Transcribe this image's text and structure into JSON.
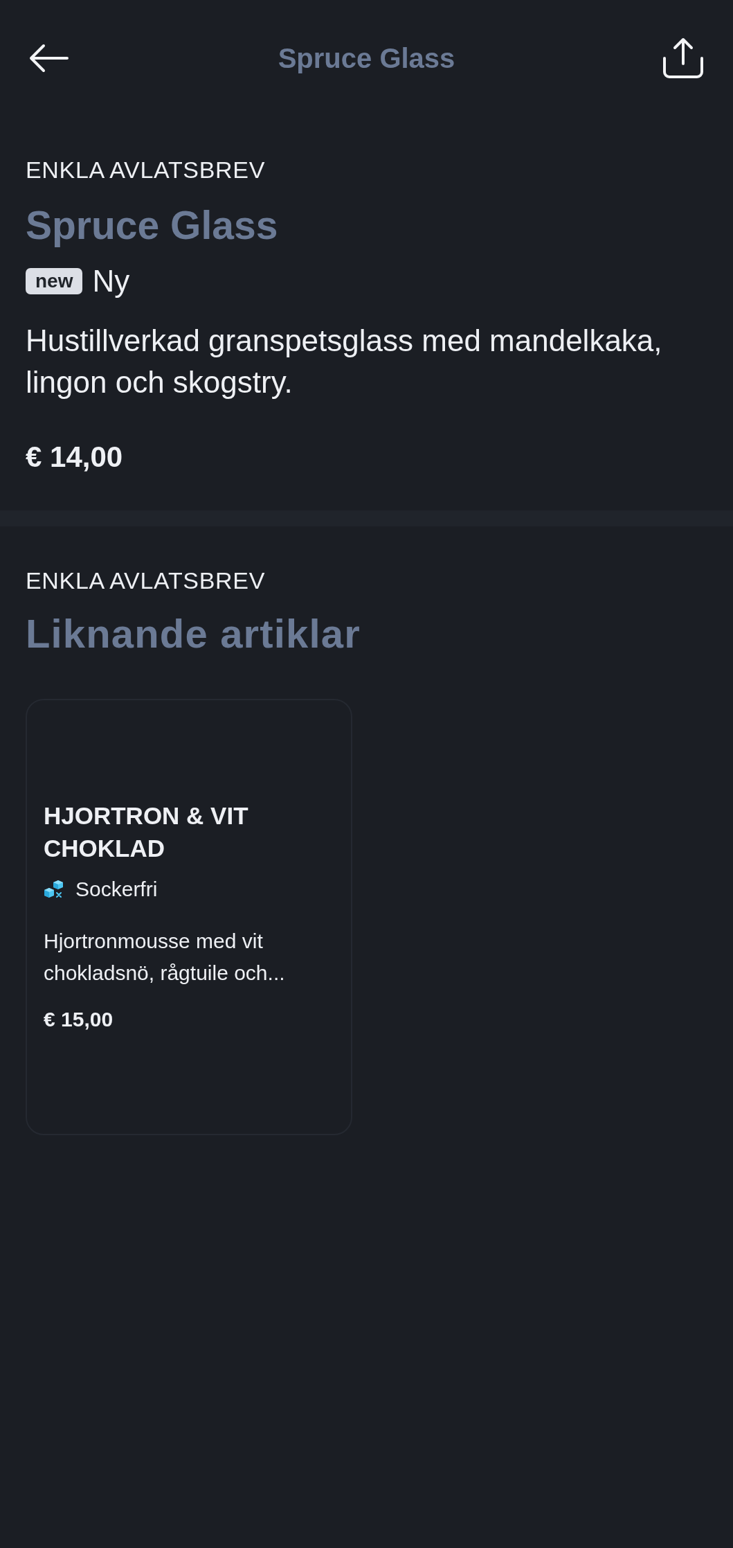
{
  "header": {
    "title": "Spruce Glass"
  },
  "product": {
    "category": "ENKLA AVLATSBREV",
    "name": "Spruce Glass",
    "badges": [
      {
        "tag": "new",
        "label": "Ny"
      }
    ],
    "description": "Hustillverkad granspetsglass med mandelkaka, lingon och skogstry.",
    "price": "€ 14,00"
  },
  "related": {
    "category": "ENKLA AVLATSBREV",
    "heading": "Liknande artiklar",
    "items": [
      {
        "name": "HJORTRON & VIT CHOKLAD",
        "attributes": [
          {
            "kind": "sugar_free",
            "label": "Sockerfri"
          }
        ],
        "description": "Hjortronmousse med vit chokladsnö, rågtuile och...",
        "price": "€ 15,00"
      }
    ]
  }
}
